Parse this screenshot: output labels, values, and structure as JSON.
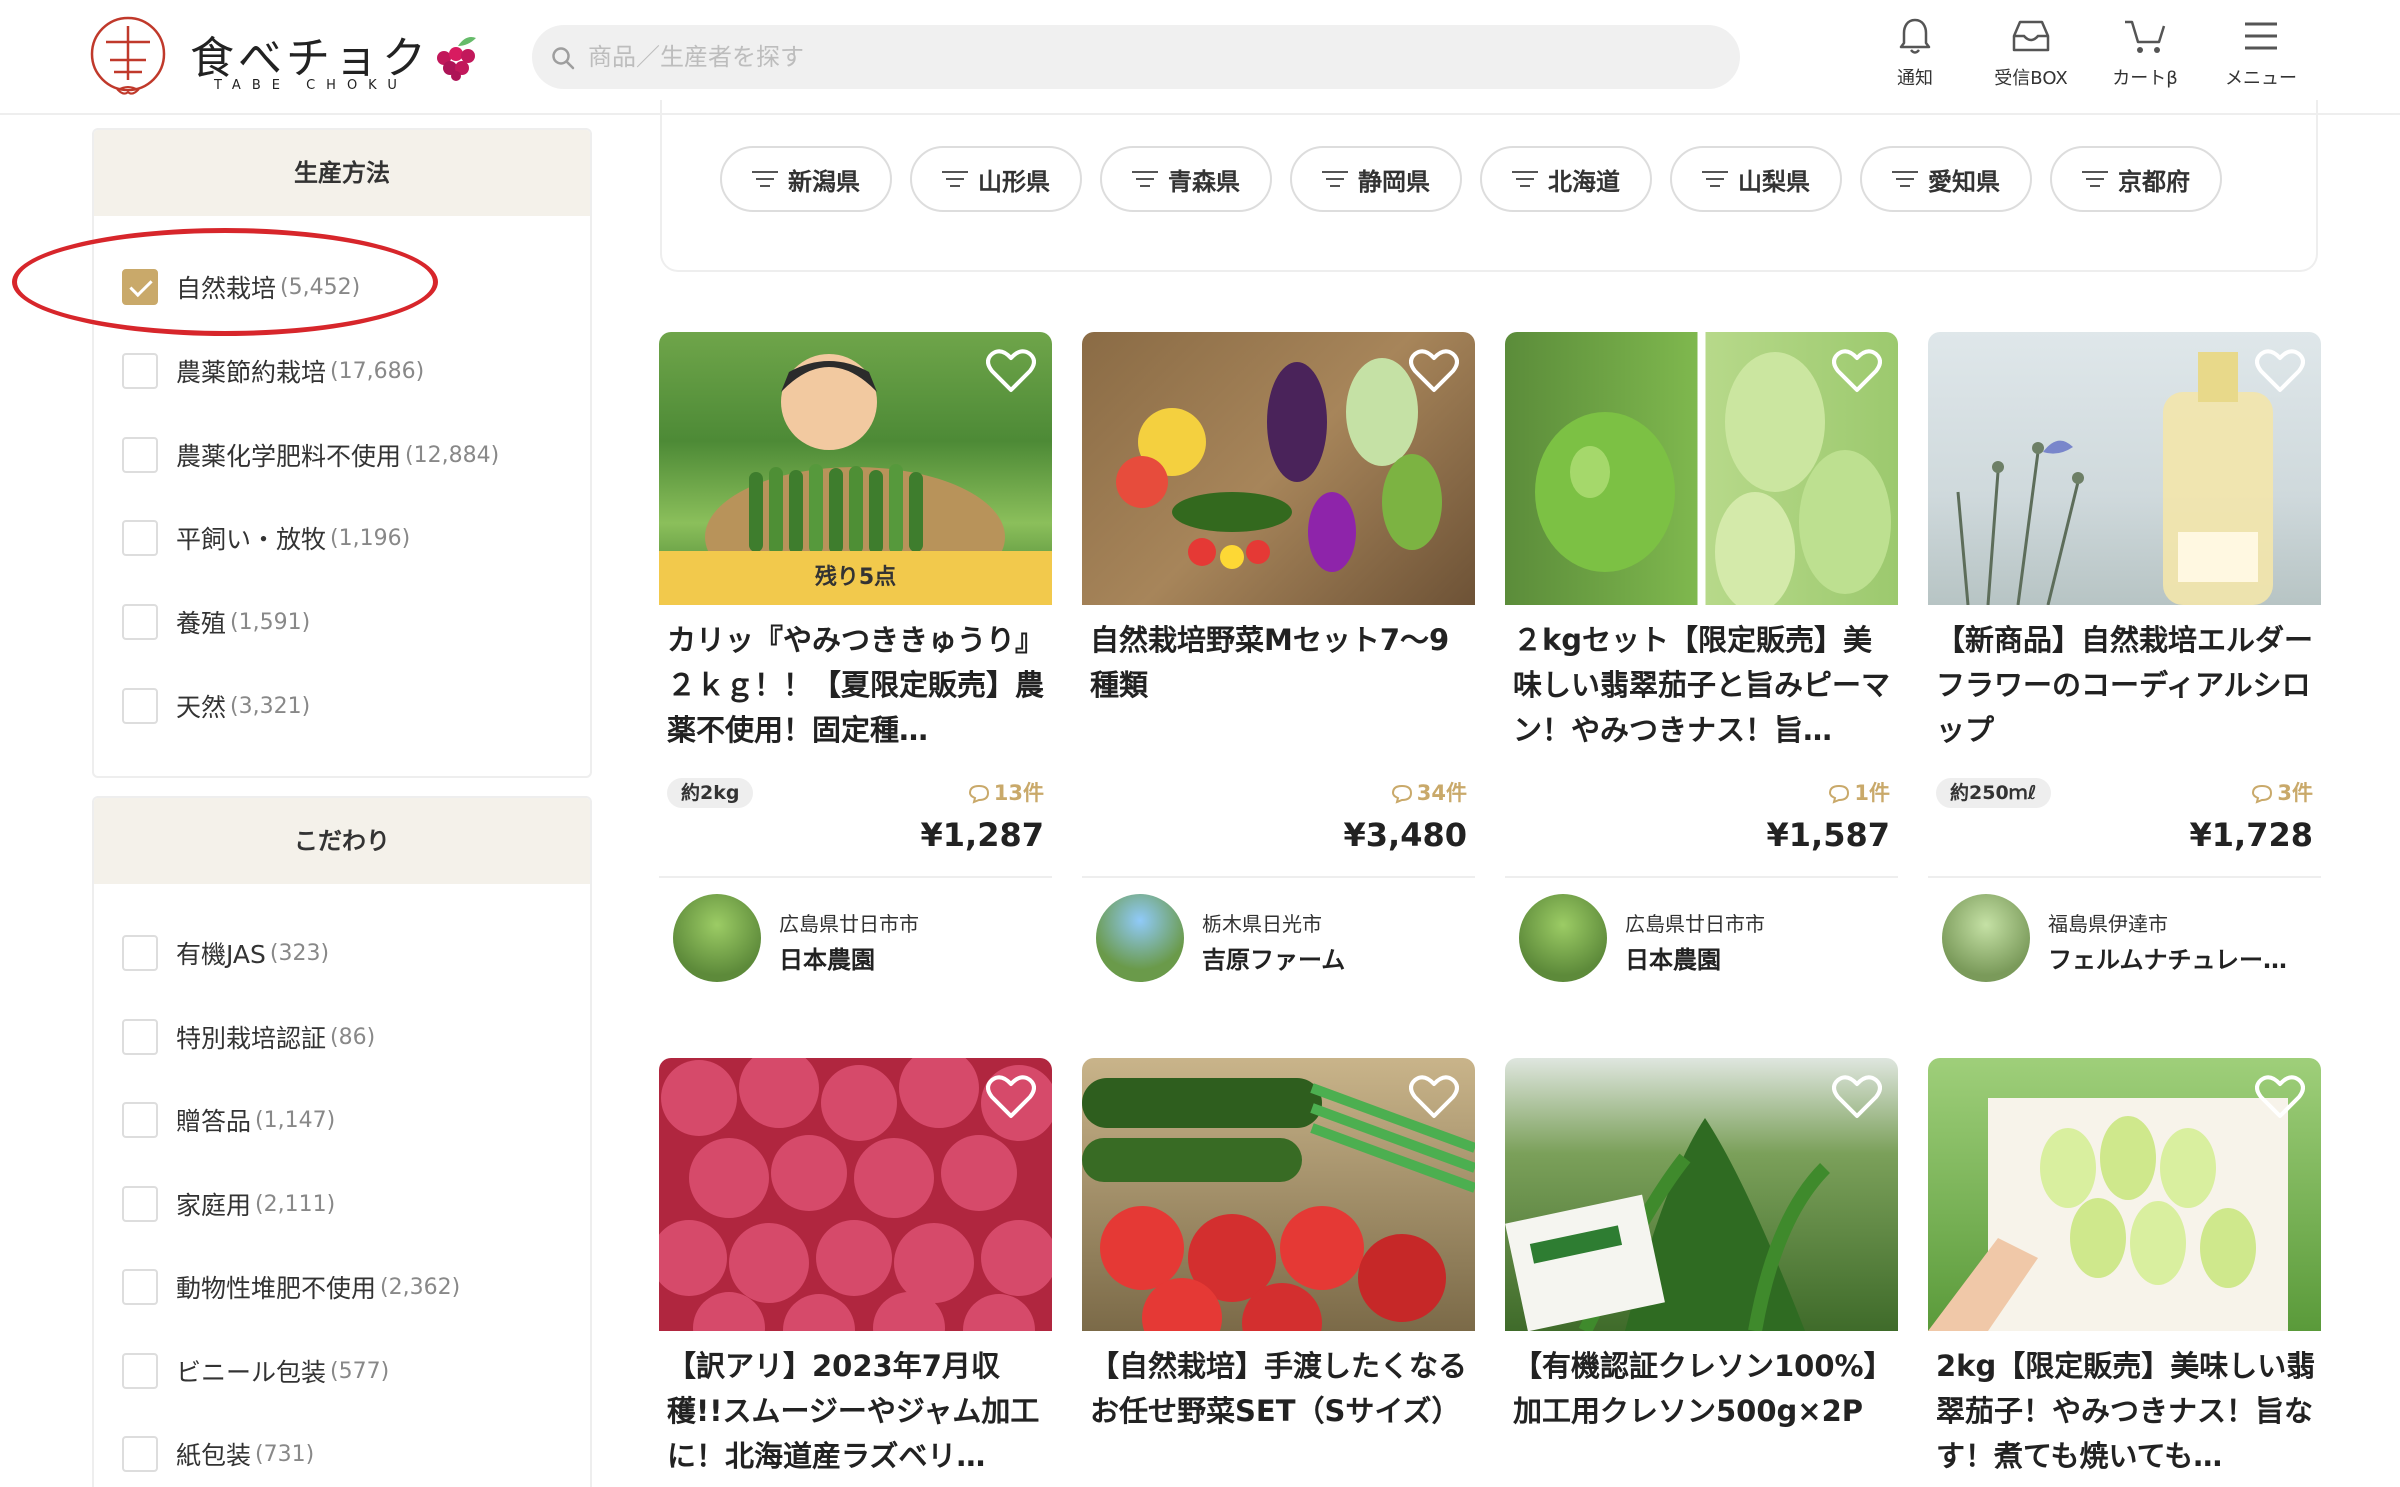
{
  "brand": {
    "name": "食べチョク",
    "sub": "TABE CHOKU"
  },
  "search": {
    "placeholder": "商品／生産者を探す"
  },
  "nav": [
    {
      "label": "通知",
      "icon": "bell-icon"
    },
    {
      "label": "受信BOX",
      "icon": "inbox-icon"
    },
    {
      "label": "カートβ",
      "icon": "cart-icon"
    },
    {
      "label": "メニュー",
      "icon": "menu-icon"
    }
  ],
  "sidebar": {
    "production": {
      "title": "生産方法",
      "items": [
        {
          "label": "自然栽培",
          "count": "(5,452)",
          "checked": true
        },
        {
          "label": "農薬節約栽培",
          "count": "(17,686)",
          "checked": false
        },
        {
          "label": "農薬化学肥料不使用",
          "count": "(12,884)",
          "checked": false
        },
        {
          "label": "平飼い・放牧",
          "count": "(1,196)",
          "checked": false
        },
        {
          "label": "養殖",
          "count": "(1,591)",
          "checked": false
        },
        {
          "label": "天然",
          "count": "(3,321)",
          "checked": false
        }
      ]
    },
    "kodawari": {
      "title": "こだわり",
      "items": [
        {
          "label": "有機JAS",
          "count": "(323)",
          "checked": false
        },
        {
          "label": "特別栽培認証",
          "count": "(86)",
          "checked": false
        },
        {
          "label": "贈答品",
          "count": "(1,147)",
          "checked": false
        },
        {
          "label": "家庭用",
          "count": "(2,111)",
          "checked": false
        },
        {
          "label": "動物性堆肥不使用",
          "count": "(2,362)",
          "checked": false
        },
        {
          "label": "ビニール包装",
          "count": "(577)",
          "checked": false
        },
        {
          "label": "紙包装",
          "count": "(731)",
          "checked": false
        }
      ]
    }
  },
  "prefectures": [
    "新潟県",
    "山形県",
    "青森県",
    "静岡県",
    "北海道",
    "山梨県",
    "愛知県",
    "京都府"
  ],
  "products": [
    {
      "title": "カリッ『やみつききゅうり』２ｋｇ！！【夏限定販売】農薬不使用！固定種…",
      "banner": "残り5点",
      "amount": "約2kg",
      "reviews": "13件",
      "price": "¥1,287",
      "pref": "広島県廿日市市",
      "farm": "日本農園"
    },
    {
      "title": "自然栽培野菜Mセット7〜9種類",
      "banner": "",
      "amount": "",
      "reviews": "34件",
      "price": "¥3,480",
      "pref": "栃木県日光市",
      "farm": "吉原ファーム"
    },
    {
      "title": "２kgセット【限定販売】美味しい翡翠茄子と旨みピーマン！やみつきナス！旨…",
      "banner": "",
      "amount": "",
      "reviews": "1件",
      "price": "¥1,587",
      "pref": "広島県廿日市市",
      "farm": "日本農園"
    },
    {
      "title": "【新商品】自然栽培エルダーフラワーのコーディアルシロップ",
      "banner": "",
      "amount": "約250ｍℓ",
      "reviews": "3件",
      "price": "¥1,728",
      "pref": "福島県伊達市",
      "farm": "フェルムナチュレー…"
    },
    {
      "title": "【訳アリ】2023年7月収穫!!スムージーやジャム加工に！北海道産ラズベリ…",
      "banner": "",
      "amount": "",
      "reviews": "",
      "price": "",
      "pref": "",
      "farm": ""
    },
    {
      "title": "【自然栽培】手渡したくなるお任せ野菜SET（Sサイズ）",
      "banner": "",
      "amount": "",
      "reviews": "",
      "price": "",
      "pref": "",
      "farm": ""
    },
    {
      "title": "【有機認証クレソン100%】加工用クレソン500g×2P",
      "banner": "",
      "amount": "",
      "reviews": "",
      "price": "",
      "pref": "",
      "farm": ""
    },
    {
      "title": "2kg【限定販売】美味しい翡翠茄子！やみつきナス！旨なす！煮ても焼いても…",
      "banner": "",
      "amount": "",
      "reviews": "",
      "price": "",
      "pref": "",
      "farm": ""
    }
  ],
  "colors": {
    "accent": "#c9a96a",
    "banner": "#f2c94c",
    "highlight": "#d7262b",
    "sidebar_head": "#f4f1ea"
  }
}
